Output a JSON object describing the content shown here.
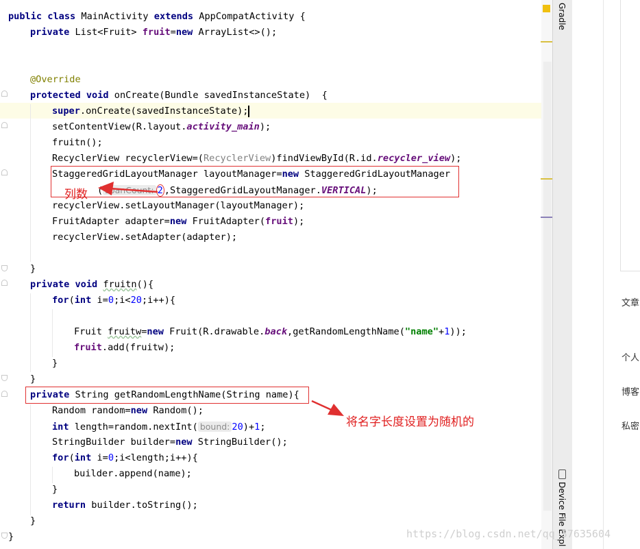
{
  "code": {
    "l1": {
      "a": "public class",
      "b": " MainActivity ",
      "c": "extends",
      "d": " AppCompatActivity {"
    },
    "l2": {
      "a": "private",
      "b": " List<Fruit> ",
      "c": "fruit",
      "d": "=",
      "e": "new",
      "f": " ArrayList<>();"
    },
    "l5": {
      "a": "@Override"
    },
    "l6": {
      "a": "protected void",
      "b": " onCreate(Bundle savedInstanceState)  {"
    },
    "l7": {
      "a": "super",
      "b": ".onCreate(savedInstanceState);"
    },
    "l8": {
      "a": "setContentView(R.layout.",
      "b": "activity_main",
      "c": ");"
    },
    "l9": {
      "a": "fruitn();"
    },
    "l10": {
      "a": "RecyclerView recyclerView=(",
      "b": "RecyclerView",
      "c": ")findViewById(R.id.",
      "d": "recycler_view",
      "e": ");"
    },
    "l11": {
      "a": "StaggeredGridLayoutManager layoutManager=",
      "b": "new",
      "c": " StaggeredGridLayoutManager"
    },
    "l12": {
      "a": "(",
      "hint": "spanCount:",
      "b": "2",
      ",": ",",
      "c": "StaggeredGridLayoutManager.",
      "d": "VERTICAL",
      "e": ");"
    },
    "l13": {
      "a": "recyclerView.setLayoutManager(layoutManager);"
    },
    "l14": {
      "a": "FruitAdapter adapter=",
      "b": "new",
      "c": " FruitAdapter(",
      "d": "fruit",
      "e": ");"
    },
    "l15": {
      "a": "recyclerView.setAdapter(adapter);"
    },
    "l17": {
      "a": "}"
    },
    "l18": {
      "a": "private void",
      "b": " ",
      "c": "fruitn",
      "d": "(){"
    },
    "l19": {
      "a": "for",
      "b": "(",
      "c": "int",
      "d": " i=",
      "e": "0",
      "f": ";i<",
      "g": "20",
      "h": ";i++){"
    },
    "l21": {
      "a": "Fruit ",
      "b": "fruitw",
      "c": "=",
      "d": "new",
      "e": " Fruit(R.drawable.",
      "f": "back",
      "g": ",getRandomLengthName(",
      "h": "\"name\"",
      "i": "+",
      "j": "1",
      "k": "));"
    },
    "l22": {
      "a": "fruit",
      "b": ".add(fruitw);"
    },
    "l23": {
      "a": "}"
    },
    "l24": {
      "a": "}"
    },
    "l25": {
      "a": "private",
      "b": " String getRandomLengthName(String name){"
    },
    "l26": {
      "a": "Random random=",
      "b": "new",
      "c": " Random();"
    },
    "l27": {
      "a": "int",
      "b": " length=random.nextInt(",
      "hint": "bound:",
      "c": "20",
      "d": ")+",
      "e": "1",
      "f": ";"
    },
    "l28": {
      "a": "StringBuilder builder=",
      "b": "new",
      "c": " StringBuilder();"
    },
    "l29": {
      "a": "for",
      "b": "(",
      "c": "int",
      "d": " i=",
      "e": "0",
      "f": ";i<length;i++){"
    },
    "l30": {
      "a": "builder.append(name);"
    },
    "l31": {
      "a": "}"
    },
    "l32": {
      "a": "return",
      "b": " builder.toString();"
    },
    "l33": {
      "a": "}"
    },
    "l34": {
      "a": "}"
    }
  },
  "annotations": {
    "column_count": "列数",
    "random_length": "将名字长度设置为随机的"
  },
  "tool_windows": {
    "gradle": "Gradle",
    "device_file_explorer": "Device File Expl"
  },
  "blog_sidebar": [
    "文章",
    "个人",
    "博客",
    "私密"
  ],
  "watermark": "https://blog.csdn.net/qq_37635604",
  "colors": {
    "keyword": "#000080",
    "annotation": "#808000",
    "number": "#0000ff",
    "string": "#008000",
    "field": "#660e7a",
    "callout": "#e03030"
  }
}
